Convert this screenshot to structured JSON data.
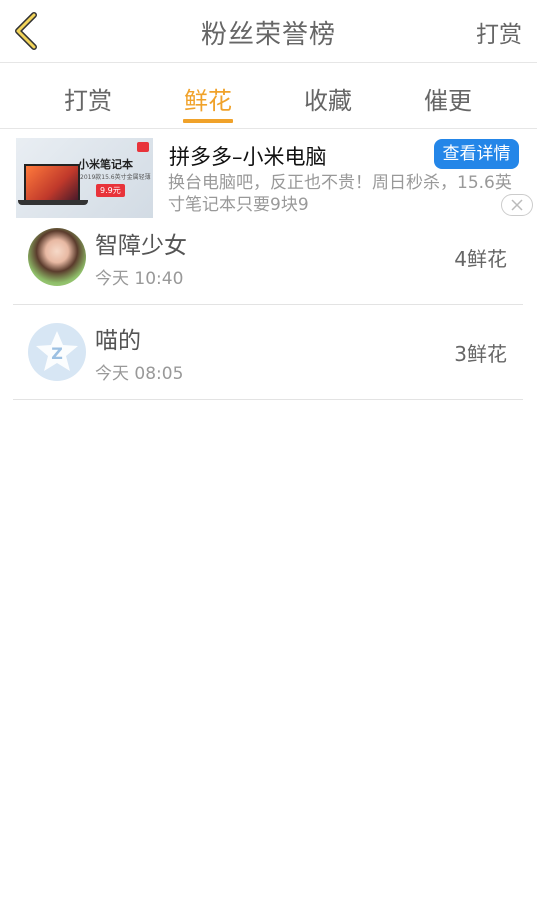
{
  "header": {
    "title": "粉丝荣誉榜",
    "right_link": "打赏"
  },
  "tabs": [
    {
      "label": "打赏",
      "active": false
    },
    {
      "label": "鲜花",
      "active": true
    },
    {
      "label": "收藏",
      "active": false
    },
    {
      "label": "催更",
      "active": false
    }
  ],
  "ad": {
    "title": "拼多多–小米电脑",
    "button": "查看详情",
    "description": "换台电脑吧，反正也不贵！周日秒杀，15.6英寸笔记本只要9块9",
    "image_title": "小米笔记本",
    "image_subtitle": "2019款15.6英寸金属轻薄",
    "image_price": "9.9元"
  },
  "fans": [
    {
      "name": "智障少女",
      "time": "今天 10:40",
      "count": "4鲜花",
      "avatar": "photo"
    },
    {
      "name": "喵的",
      "time": "今天 08:05",
      "count": "3鲜花",
      "avatar": "default"
    }
  ],
  "colors": {
    "accent": "#f0a22a",
    "ad_button": "#2486e8"
  }
}
